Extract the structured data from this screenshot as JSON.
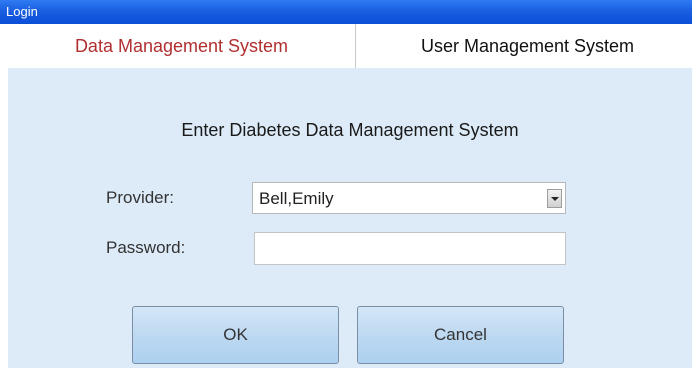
{
  "window": {
    "title": "Login"
  },
  "tabs": [
    {
      "label": "Data Management System",
      "active": true
    },
    {
      "label": "User Management System",
      "active": false
    }
  ],
  "form": {
    "heading": "Enter Diabetes Data Management System",
    "provider_label": "Provider:",
    "provider_value": "Bell,Emily",
    "password_label": "Password:",
    "password_value": ""
  },
  "buttons": {
    "ok": "OK",
    "cancel": "Cancel"
  },
  "colors": {
    "titlebar": "#1a5fe0",
    "active_tab_text": "#b03030",
    "panel_bg": "#dcebf7",
    "button_bg": "#bcd8f1"
  },
  "icons": {
    "dropdown": "chevron-down-icon"
  }
}
